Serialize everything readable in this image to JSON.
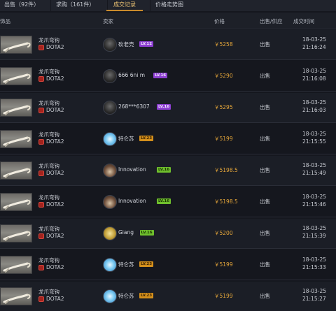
{
  "tabs": [
    {
      "label": "出售（92件）",
      "active": false
    },
    {
      "label": "求购（161件）",
      "active": false
    },
    {
      "label": "成交记录",
      "active": true
    },
    {
      "label": "价格走势图",
      "active": false
    }
  ],
  "table": {
    "headers": {
      "item": "饰品",
      "seller": "卖家",
      "price": "价格",
      "type": "出售/供应",
      "time": "成交时间"
    },
    "rows": [
      {
        "item": "龙爪弯钩",
        "game": "DOTA2",
        "seller": "砍老壳",
        "avatar": "dark",
        "level": "LV.12",
        "level_color": "purple",
        "price": "￥5258",
        "type": "出售",
        "date": "18-03-25",
        "time": "21:16:24"
      },
      {
        "item": "龙爪弯钩",
        "game": "DOTA2",
        "seller": "666 6ni m",
        "avatar": "dark",
        "level": "LV.16",
        "level_color": "purple",
        "price": "￥5290",
        "type": "出售",
        "date": "18-03-25",
        "time": "21:16:08"
      },
      {
        "item": "龙爪弯钩",
        "game": "DOTA2",
        "seller": "268***6307",
        "avatar": "dark",
        "level": "LV.16",
        "level_color": "purple",
        "price": "￥5295",
        "type": "出售",
        "date": "18-03-25",
        "time": "21:16:03"
      },
      {
        "item": "龙爪弯钩",
        "game": "DOTA2",
        "seller": "特仑苏",
        "avatar": "blue",
        "level": "LV.23",
        "level_color": "orange",
        "price": "￥5199",
        "type": "出售",
        "date": "18-03-25",
        "time": "21:15:55"
      },
      {
        "item": "龙爪弯钩",
        "game": "DOTA2",
        "seller": "Innovation",
        "avatar": "wing",
        "level": "LV.16",
        "level_color": "green",
        "price": "￥5198.5",
        "type": "出售",
        "date": "18-03-25",
        "time": "21:15:49"
      },
      {
        "item": "龙爪弯钩",
        "game": "DOTA2",
        "seller": "Innovation",
        "avatar": "wing",
        "level": "LV.16",
        "level_color": "green",
        "price": "￥5198.5",
        "type": "出售",
        "date": "18-03-25",
        "time": "21:15:46"
      },
      {
        "item": "龙爪弯钩",
        "game": "DOTA2",
        "seller": "Giang",
        "avatar": "coin",
        "level": "LV.16",
        "level_color": "green",
        "price": "￥5200",
        "type": "出售",
        "date": "18-03-25",
        "time": "21:15:39"
      },
      {
        "item": "龙爪弯钩",
        "game": "DOTA2",
        "seller": "特仑苏",
        "avatar": "blue",
        "level": "LV.23",
        "level_color": "orange",
        "price": "￥5199",
        "type": "出售",
        "date": "18-03-25",
        "time": "21:15:33"
      },
      {
        "item": "龙爪弯钩",
        "game": "DOTA2",
        "seller": "特仑苏",
        "avatar": "blue",
        "level": "LV.23",
        "level_color": "orange",
        "price": "￥5199",
        "type": "出售",
        "date": "18-03-25",
        "time": "21:15:27"
      }
    ]
  },
  "colors": {
    "accent": "#c98a2c",
    "price": "#e8a83a",
    "background": "#15171e"
  },
  "icons": {
    "item_thumbnail": "hook-weapon-icon",
    "game": "dota2-icon"
  }
}
